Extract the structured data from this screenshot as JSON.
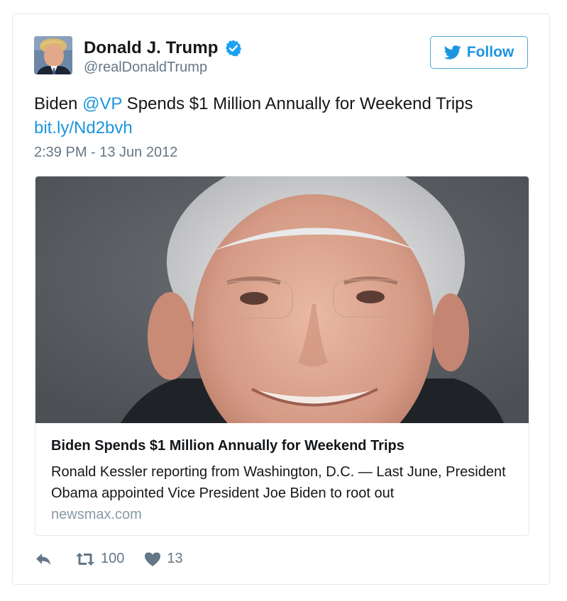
{
  "user": {
    "name": "Donald J. Trump",
    "handle": "@realDonaldTrump",
    "verified_icon": "verified-badge-icon"
  },
  "follow_button": {
    "label": "Follow",
    "icon": "twitter-bird-icon"
  },
  "tweet": {
    "text_before": "Biden ",
    "mention": "@VP",
    "text_after": " Spends $1 Million Annually for Weekend Trips",
    "link": "bit.ly/Nd2bvh",
    "timestamp": "2:39 PM - 13 Jun 2012"
  },
  "card": {
    "title": "Biden Spends $1 Million Annually for Weekend Trips",
    "description": "Ronald Kessler reporting from Washington, D.C. — Last June, President Obama appointed Vice President Joe Biden to root out",
    "domain": "newsmax.com"
  },
  "actions": {
    "retweets": "100",
    "likes": "13"
  },
  "colors": {
    "link": "#1b95e0",
    "muted": "#657786",
    "border": "#e1e8ed"
  }
}
